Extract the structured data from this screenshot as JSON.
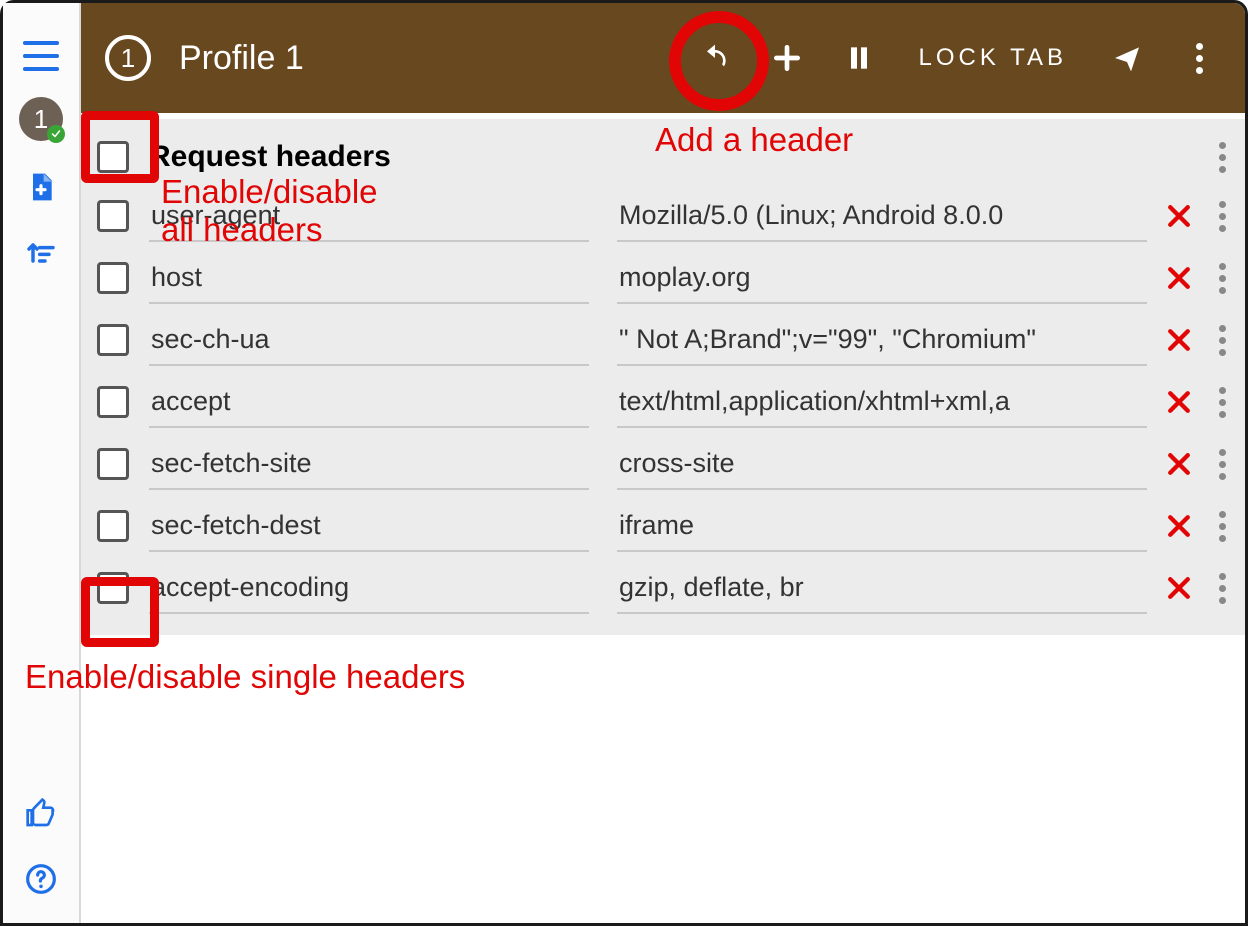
{
  "sidebar": {
    "profile_number": "1"
  },
  "appbar": {
    "circle_number": "1",
    "title": "Profile 1",
    "lock_tab": "LOCK TAB"
  },
  "section": {
    "title": "Request headers"
  },
  "headers": [
    {
      "name": "user-agent",
      "value": "Mozilla/5.0 (Linux; Android 8.0.0"
    },
    {
      "name": "host",
      "value": "moplay.org"
    },
    {
      "name": "sec-ch-ua",
      "value": "\" Not A;Brand\";v=\"99\", \"Chromium\""
    },
    {
      "name": "accept",
      "value": "text/html,application/xhtml+xml,a"
    },
    {
      "name": "sec-fetch-site",
      "value": "cross-site"
    },
    {
      "name": "sec-fetch-dest",
      "value": "iframe"
    },
    {
      "name": "accept-encoding",
      "value": "gzip, deflate, br"
    }
  ],
  "annotations": {
    "add_header": "Add a header",
    "enable_all": "Enable/disable\nall headers",
    "enable_single": "Enable/disable single headers"
  }
}
